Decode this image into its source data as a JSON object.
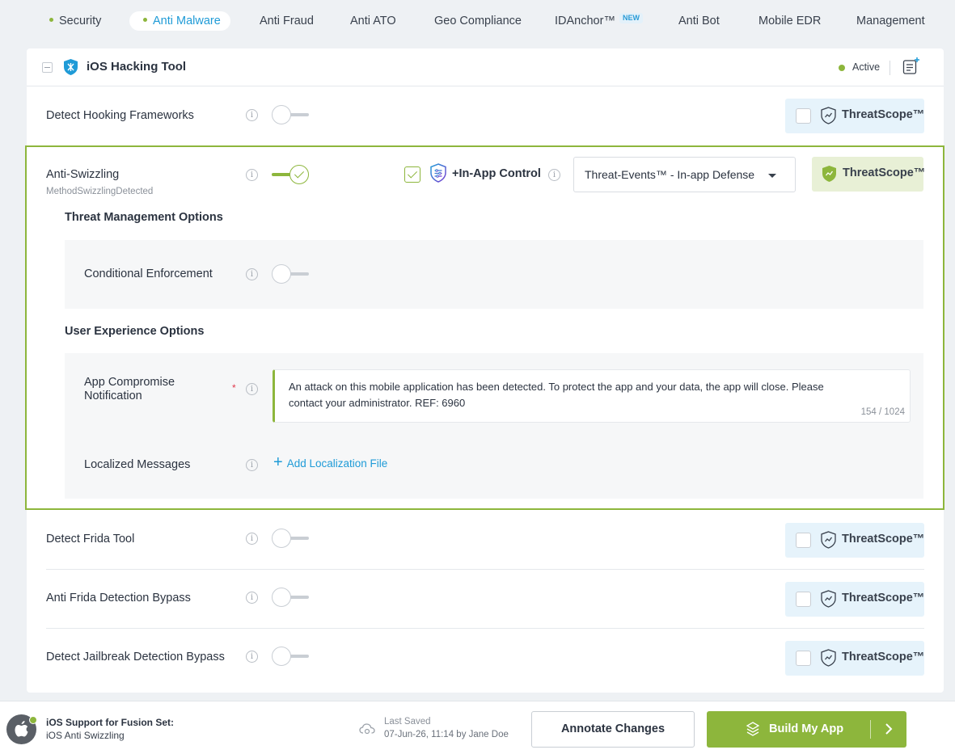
{
  "tabs": [
    {
      "label": "Security",
      "dot": true
    },
    {
      "label": "Anti Malware",
      "dot": true,
      "active": true
    },
    {
      "label": "Anti Fraud"
    },
    {
      "label": "Anti ATO"
    },
    {
      "label": "Geo Compliance"
    },
    {
      "label": "IDAnchor™",
      "badge": "NEW"
    },
    {
      "label": "Anti Bot"
    },
    {
      "label": "Mobile EDR"
    },
    {
      "label": "Management"
    }
  ],
  "card": {
    "title": "iOS Hacking Tool",
    "status": "Active"
  },
  "threatscope_label": "ThreatScope™",
  "rows": {
    "hooking": {
      "label": "Detect Hooking Frameworks",
      "enabled": false
    },
    "swizzling": {
      "label": "Anti-Swizzling",
      "sub": "MethodSwizzlingDetected",
      "enabled": true,
      "in_app_control_label": "+In-App Control",
      "in_app_control_checked": true,
      "defense_select": "Threat-Events™ - In-app Defense",
      "threat_mgmt_title": "Threat Management Options",
      "conditional_label": "Conditional Enforcement",
      "conditional_enabled": false,
      "ux_title": "User Experience Options",
      "notification_label": "App Compromise Notification",
      "notification_required_mark": "*",
      "notification_text": "An attack on this mobile application has been detected. To protect the app and your data, the app will close. Please contact your administrator. REF: 6960",
      "notification_count": "154 / 1024",
      "localized_label": "Localized Messages",
      "add_localization": "Add Localization File"
    },
    "frida": {
      "label": "Detect Frida Tool",
      "enabled": false
    },
    "frida_bypass": {
      "label": "Anti Frida Detection Bypass",
      "enabled": false
    },
    "jailbreak_bypass": {
      "label": "Detect Jailbreak Detection Bypass",
      "enabled": false
    }
  },
  "footer": {
    "fusion_label": "iOS Support for Fusion Set:",
    "fusion_name": "iOS Anti Swizzling",
    "last_saved_label": "Last Saved",
    "last_saved_value": "07-Jun-26, 11:14 by Jane Doe",
    "annotate_label": "Annotate Changes",
    "build_label": "Build My App"
  },
  "colors": {
    "accent_green": "#8db63c",
    "link_blue": "#1f9bd7",
    "threatscope_bg": "#e6f3fb",
    "required_red": "#e0384b"
  },
  "icons": [
    "collapse-icon",
    "ios-shield-icon",
    "add-note-icon",
    "info-icon",
    "threatscope-shield-icon",
    "in-app-control-icon",
    "chevron-down-icon",
    "plus-icon",
    "apple-icon",
    "cloud-icon",
    "build-icon",
    "chevron-right-icon"
  ]
}
